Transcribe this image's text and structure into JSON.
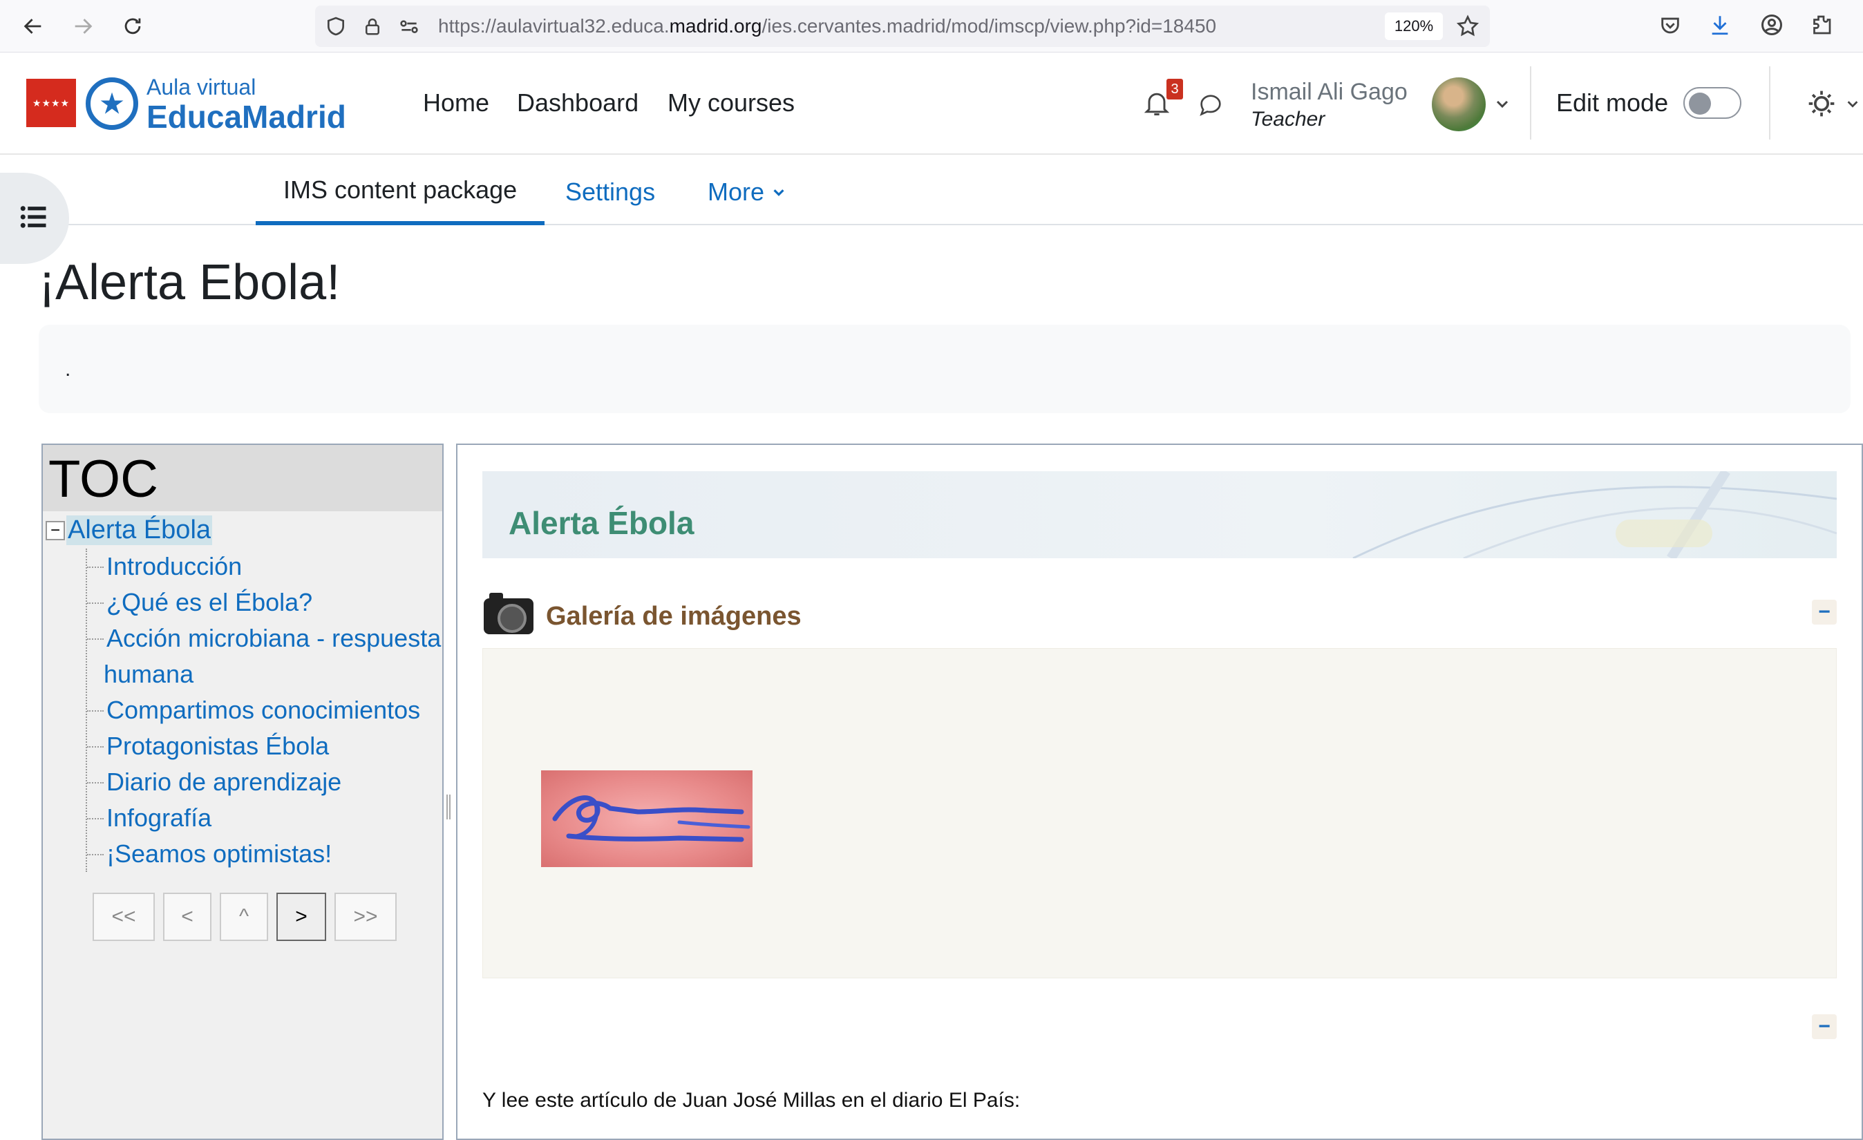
{
  "browser": {
    "url_prefix": "https://aulavirtual32.educa.",
    "url_domain": "madrid.org",
    "url_path": "/ies.cervantes.madrid/mod/imscp/view.php?id=18450",
    "zoom": "120%"
  },
  "brand": {
    "line1": "Aula virtual",
    "line2": "EducaMadrid",
    "flag_stars": "★★★★"
  },
  "topnav": {
    "home": "Home",
    "dashboard": "Dashboard",
    "my_courses": "My courses"
  },
  "notifications": {
    "count": "3"
  },
  "user": {
    "name": "Ismail Ali Gago",
    "role": "Teacher"
  },
  "edit_mode": {
    "label": "Edit mode",
    "enabled": false
  },
  "secondary_nav": {
    "tab1": "IMS content package",
    "tab2": "Settings",
    "tab3": "More"
  },
  "page": {
    "title": "¡Alerta Ebola!",
    "description": "."
  },
  "toc": {
    "heading": "TOC",
    "root": "Alerta Ébola",
    "items": [
      "Introducción",
      "¿Qué es el Ébola?",
      "Acción microbiana - respuesta",
      "Compartimos conocimientos",
      "Protagonistas Ébola",
      "Diario de aprendizaje",
      "Infografía",
      "¡Seamos optimistas!"
    ],
    "item3_continuation": "humana",
    "buttons": {
      "first": "<<",
      "prev": "<",
      "up": "^",
      "next": ">",
      "last": ">>"
    }
  },
  "content": {
    "title": "Alerta Ébola",
    "gallery_title": "Galería de imágenes",
    "collapse_symbol": "−",
    "article_intro": "Y lee este artículo de Juan José Millas en el diario El País:"
  },
  "colors": {
    "accent": "#0f6cbf",
    "content_title": "#3e8d74",
    "gallery_title": "#7a5530",
    "badge": "#ca3120"
  }
}
